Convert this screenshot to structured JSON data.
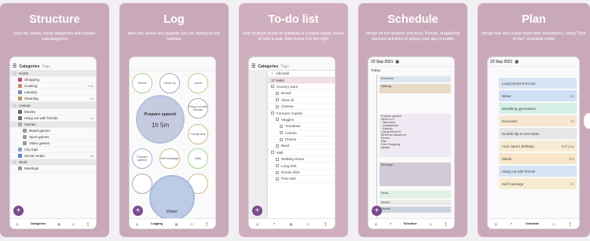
{
  "cards": [
    {
      "title": "Structure",
      "subtitle": "your life clearly using categories with nested subcategories"
    },
    {
      "title": "Log",
      "subtitle": "time you spend and quantity you do, taping on the bubbles"
    },
    {
      "title": "To-do list",
      "subtitle": "with multiple levels of subtasks is created easily: press & hold a task, then move it to the right"
    },
    {
      "title": "Schedule",
      "subtitle": "things on the timeline precisely. Resize, drag&drop planned activities to adjust your day to reality"
    },
    {
      "title": "Plan",
      "subtitle": "things that don't have exact time boundaries, using \"Part of day\" schedule mode"
    }
  ],
  "structure": {
    "tabs": [
      "Categories",
      "Tags"
    ],
    "rows": [
      {
        "label": "Home",
        "color": "#d6d6d6",
        "level": 0,
        "group": true
      },
      {
        "label": "Shopping",
        "color": "#c64b6d",
        "level": 1
      },
      {
        "label": "Cooking",
        "color": "#c98a60",
        "level": 1,
        "right": "1.0h"
      },
      {
        "label": "Laundry",
        "color": "#7a8ab8",
        "level": 1
      },
      {
        "label": "Cleaning",
        "color": "#b99c5e",
        "level": 1,
        "right": "2d"
      },
      {
        "label": "Leisure",
        "color": "#d6d6d6",
        "level": 0,
        "group": true
      },
      {
        "label": "Movies",
        "color": "#5d6b86",
        "level": 1
      },
      {
        "label": "Hang out with friends",
        "color": "#6c6c6c",
        "level": 1,
        "right": "2d"
      },
      {
        "label": "Games",
        "color": "#aaaaaa",
        "level": 1,
        "group": true
      },
      {
        "label": "Board games",
        "color": "#999999",
        "level": 2
      },
      {
        "label": "Sport games",
        "color": "#999999",
        "level": 2
      },
      {
        "label": "Video games",
        "color": "#999999",
        "level": 2
      },
      {
        "label": "City trips",
        "color": "#8aa0c8",
        "level": 1
      },
      {
        "label": "Social media",
        "color": "#5b7fc9",
        "level": 1,
        "right": "5d"
      },
      {
        "label": "Work",
        "color": "#d6d6d6",
        "level": 0,
        "group": true
      },
      {
        "label": "Meetings",
        "color": "#999999",
        "level": 1
      }
    ],
    "nav": [
      "Categories",
      "",
      "",
      "",
      ""
    ]
  },
  "log": {
    "bubbles": [
      {
        "label": "Dinner"
      },
      {
        "label": "Clean up"
      },
      {
        "label": "Lunch"
      },
      {
        "label": "Hang out with friends"
      },
      {
        "label": "Family time"
      },
      {
        "label": "Prepare speech"
      },
      {
        "label": "Self massage"
      },
      {
        "label": "Walk"
      },
      {
        "label": ""
      },
      {
        "label": ""
      },
      {
        "label": ""
      }
    ],
    "active": {
      "label": "Prepare speech",
      "time": "1h 5m"
    },
    "water": "Water",
    "nav": [
      "",
      "Logging",
      "",
      "",
      ""
    ]
  },
  "todo": {
    "tabs": [
      "Categories",
      "Tags"
    ],
    "add": "Add task",
    "rows": [
      {
        "label": "17 tasks",
        "type": "hd"
      },
      {
        "label": "Grocery store",
        "type": "group"
      },
      {
        "label": "Bread",
        "type": "ind"
      },
      {
        "label": "Olive oil",
        "type": "ind"
      },
      {
        "label": "Cheese",
        "type": "ind"
      },
      {
        "label": "Farmers' market",
        "type": "group"
      },
      {
        "label": "Veggies",
        "type": "ind"
      },
      {
        "label": "Tomatoes",
        "type": "ind2"
      },
      {
        "label": "Carrots",
        "type": "ind2"
      },
      {
        "label": "Onions",
        "type": "ind2"
      },
      {
        "label": "Basil",
        "type": "ind"
      },
      {
        "label": "Mall",
        "type": "group"
      },
      {
        "label": "Walking shoes",
        "type": "ind"
      },
      {
        "label": "Long skirt",
        "type": "ind"
      },
      {
        "label": "Dream shirt",
        "type": "ind"
      },
      {
        "label": "Polo shirt",
        "type": "ind"
      }
    ]
  },
  "schedule": {
    "date": "23 Sep 2021",
    "today": "Today",
    "blocks": [
      {
        "label": "Exercises",
        "color": "#dfe6ef"
      },
      {
        "label": "Walking",
        "color": "#e8d9c7"
      },
      {
        "label": "Prepare speech\nWork on it\n- New lines\n- Smartphone\n- Backup\nCall guest list 5\nWhat we missed on\nDinner\nPlan\n5 for Shopping\nplease",
        "color": "#efe9f3"
      },
      {
        "label": "Meetings",
        "color": "#d3cad8"
      },
      {
        "label": "Relax",
        "color": "#e1f0e4"
      },
      {
        "label": "Dinner",
        "color": "#e8e8e8"
      },
      {
        "label": "Movies",
        "color": "#ccd3de"
      }
    ],
    "nav": [
      "",
      "",
      "Schedule",
      "",
      ""
    ]
  },
  "plan": {
    "date": "23 Sep 2021",
    "rows": [
      {
        "label": "Load photos from trip",
        "color": "#d8e4f3"
      },
      {
        "label": "Water",
        "color": "#cfe0f4"
      },
      {
        "label": "Breathing gymnastics",
        "color": "#d5efe7"
      },
      {
        "label": "Exercises",
        "color": "#f6e8d0"
      },
      {
        "label": "Double tap to set marks",
        "color": "#e6e6e6"
      },
      {
        "label": "Aunt Jane's birthday",
        "color": "#f7ecd2"
      },
      {
        "label": "Meals",
        "color": "#f7e6c7"
      },
      {
        "label": "Hang out with friends",
        "color": "#d8e4f3"
      },
      {
        "label": "Self massage",
        "color": "#f7ecd2"
      }
    ],
    "rights": [
      "",
      "5d",
      "",
      "1h",
      "",
      "Birthday",
      "5m",
      "",
      "1h"
    ],
    "nav": [
      "",
      "",
      "Schedule",
      "",
      ""
    ]
  }
}
